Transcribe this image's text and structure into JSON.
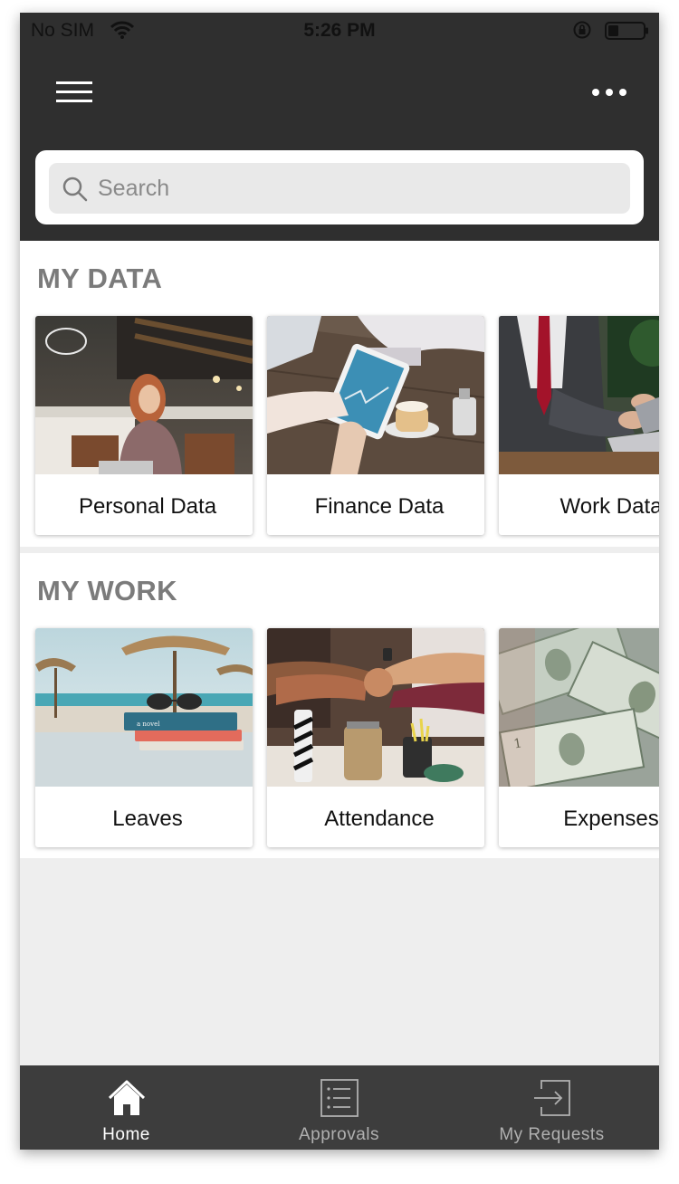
{
  "status_bar": {
    "carrier": "No SIM",
    "time": "5:26 PM"
  },
  "header": {
    "search": {
      "placeholder": "Search",
      "value": ""
    }
  },
  "sections": {
    "my_data": {
      "title": "MY DATA",
      "cards": [
        {
          "label": "Personal Data"
        },
        {
          "label": "Finance Data"
        },
        {
          "label": "Work Data"
        }
      ]
    },
    "my_work": {
      "title": "MY WORK",
      "cards": [
        {
          "label": "Leaves"
        },
        {
          "label": "Attendance"
        },
        {
          "label": "Expenses"
        }
      ]
    }
  },
  "tab_bar": {
    "tabs": [
      {
        "label": "Home",
        "icon": "home-icon",
        "active": true
      },
      {
        "label": "Approvals",
        "icon": "list-icon",
        "active": false
      },
      {
        "label": "My Requests",
        "icon": "export-icon",
        "active": false
      }
    ]
  },
  "colors": {
    "header_bg": "#2f2f2f",
    "tab_bar_bg": "#3d3d3d",
    "section_title": "#7b7b7b",
    "page_bg": "#eeeeee"
  }
}
